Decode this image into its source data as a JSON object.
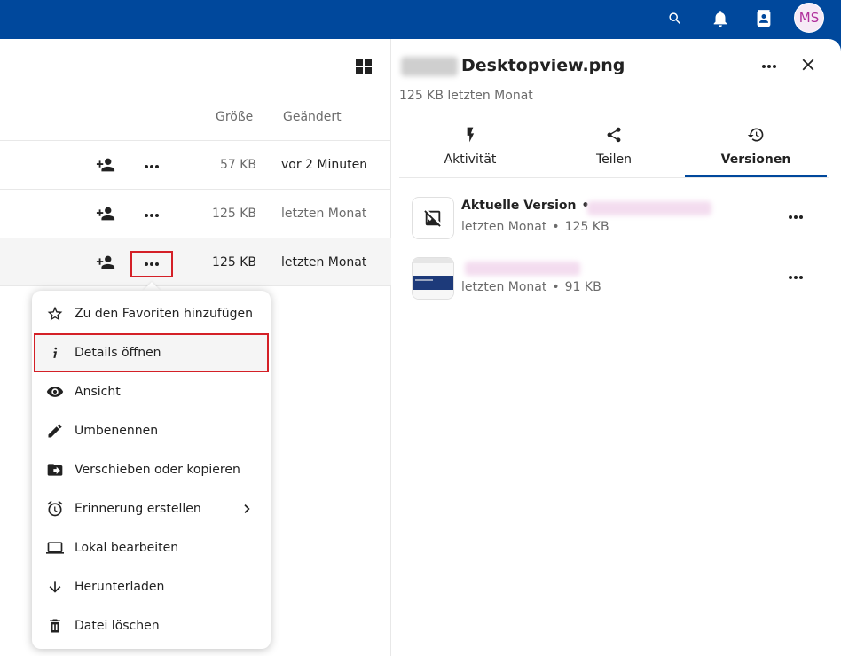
{
  "header": {
    "search_icon": "search-icon",
    "notifications_icon": "bell-icon",
    "contacts_icon": "contacts-icon",
    "avatar_initials": "MS"
  },
  "files": {
    "columns": {
      "size": "Größe",
      "modified": "Geändert"
    },
    "rows": [
      {
        "size": "57 KB",
        "modified": "vor 2 Minuten"
      },
      {
        "size": "125 KB",
        "modified": "letzten Monat"
      },
      {
        "size": "125 KB",
        "modified": "letzten Monat"
      }
    ]
  },
  "menu": {
    "items": [
      {
        "label": "Zu den Favoriten hinzufügen",
        "icon": "star-icon"
      },
      {
        "label": "Details öffnen",
        "icon": "info-icon"
      },
      {
        "label": "Ansicht",
        "icon": "eye-icon"
      },
      {
        "label": "Umbenennen",
        "icon": "pencil-icon"
      },
      {
        "label": "Verschieben oder kopieren",
        "icon": "folder-move-icon"
      },
      {
        "label": "Erinnerung erstellen",
        "icon": "alarm-icon"
      },
      {
        "label": "Lokal bearbeiten",
        "icon": "laptop-icon"
      },
      {
        "label": "Herunterladen",
        "icon": "download-icon"
      },
      {
        "label": "Datei löschen",
        "icon": "trash-icon"
      }
    ]
  },
  "sidebar": {
    "title": "Desktopview.png",
    "subtitle": "125 KB letzten Monat",
    "tabs": [
      {
        "label": "Aktivität",
        "icon": "flash-icon"
      },
      {
        "label": "Teilen",
        "icon": "share-icon"
      },
      {
        "label": "Versionen",
        "icon": "history-icon"
      }
    ],
    "versions": [
      {
        "title": "Aktuelle Version",
        "date": "letzten Monat",
        "size": "125 KB"
      },
      {
        "date": "letzten Monat",
        "size": "91 KB"
      }
    ]
  },
  "colors": {
    "brand": "#00489c",
    "highlight": "#d42027"
  }
}
